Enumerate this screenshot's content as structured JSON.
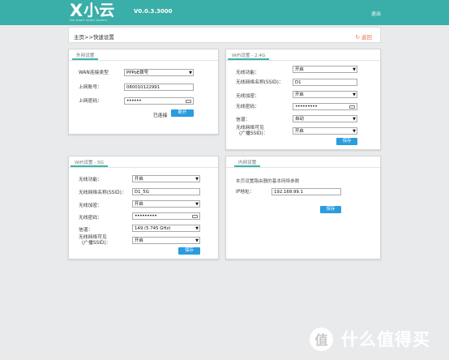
{
  "header": {
    "logo_x": "X",
    "logo_cn": "小云",
    "logo_tagline": "the smart router system",
    "version": "V0.0.3.3000",
    "logout_label": "退出"
  },
  "breadcrumb": {
    "path": "主页>>快速设置",
    "back_label": "返回",
    "back_icon": "back-arrow-icon"
  },
  "wan": {
    "tab": "外网设置",
    "fields": {
      "type_label": "WAN连接类型",
      "type_value": "PPPoE拨号",
      "account_label": "上网账号：",
      "account_value": "080010122991",
      "password_label": "上网密码：",
      "password_value": "••••••"
    },
    "status_text": "已连接",
    "disconnect_label": "断开"
  },
  "wifi24": {
    "tab": "WiFi设置 - 2.4G",
    "wifi_label": "无线功能：",
    "wifi_value": "开启",
    "ssid_label": "无线网络名称(SSID)：",
    "ssid_value": "D1",
    "encrypt_label": "无线加密：",
    "encrypt_value": "开启",
    "password_label": "无线密码：",
    "password_value": "•••••••••",
    "channel_label": "信道：",
    "channel_value": "自动",
    "broadcast_label_1": "无线网络可见",
    "broadcast_label_2": "(广播SSID)：",
    "broadcast_value": "开启",
    "save_label": "保存"
  },
  "wifi5": {
    "tab": "WiFi设置 - 5G",
    "wifi_label": "无线功能：",
    "wifi_value": "开启",
    "ssid_label": "无线网络名称(SSID)：",
    "ssid_value": "D1_5G",
    "encrypt_label": "无线加密：",
    "encrypt_value": "开启",
    "password_label": "无线密码：",
    "password_value": "•••••••••",
    "channel_label": "信道：",
    "channel_value": "149 (5.745 GHz)",
    "broadcast_label_1": "无线网络可见",
    "broadcast_label_2": "(广播SSID)：",
    "broadcast_value": "开启",
    "save_label": "保存"
  },
  "lan": {
    "tab": "内网设置",
    "note": "本页设置路由器的基本网络参数",
    "ip_label": "IP地址：",
    "ip_value": "192.168.99.1",
    "save_label": "保存"
  },
  "watermark": {
    "icon_glyph": "值",
    "text": "什么值得买"
  },
  "colors": {
    "header_bg": "#3aaea8",
    "button_blue": "#2a9de0",
    "back_orange": "#f07040",
    "page_bg": "#e9eaec"
  }
}
